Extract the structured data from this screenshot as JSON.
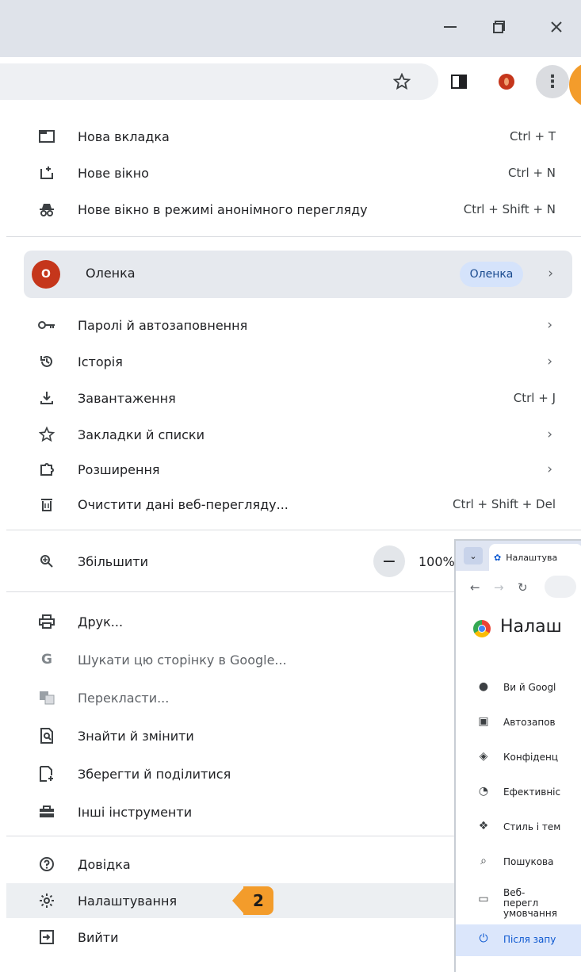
{
  "window": {
    "minimize_icon": "minimize-icon",
    "restore_icon": "restore-icon",
    "close_icon": "close-icon"
  },
  "toolbar": {
    "icons": [
      "star-icon",
      "side-panel-icon",
      "profile-avatar-icon",
      "more-vert-icon"
    ]
  },
  "menu": {
    "new_tab": {
      "label": "Нова вкладка",
      "shortcut": "Ctrl + T"
    },
    "new_window": {
      "label": "Нове вікно",
      "shortcut": "Ctrl + N"
    },
    "incognito": {
      "label": "Нове вікно в режимі анонімного перегляду",
      "shortcut": "Ctrl + Shift + N"
    },
    "profile": {
      "initial": "O",
      "name": "Оленка",
      "chip": "Оленка"
    },
    "passwords": {
      "label": "Паролі й автозаповнення"
    },
    "history": {
      "label": "Історія"
    },
    "downloads": {
      "label": "Завантаження",
      "shortcut": "Ctrl + J"
    },
    "bookmarks": {
      "label": "Закладки й списки"
    },
    "extensions": {
      "label": "Розширення"
    },
    "clear_data": {
      "label": "Очистити дані веб-перегляду...",
      "shortcut": "Ctrl + Shift + Del"
    },
    "zoom": {
      "label": "Збільшити",
      "minus": "−",
      "value": "100%"
    },
    "print": {
      "label": "Друк..."
    },
    "search_google": {
      "label": "Шукати цю сторінку в Google..."
    },
    "translate": {
      "label": "Перекласти..."
    },
    "find": {
      "label": "Знайти й змінити"
    },
    "save_share": {
      "label": "Зберегти й поділитися"
    },
    "more_tools": {
      "label": "Інші інструменти"
    },
    "help": {
      "label": "Довідка"
    },
    "settings": {
      "label": "Налаштування"
    },
    "exit": {
      "label": "Вийти"
    }
  },
  "callout": {
    "step": "2"
  },
  "inset": {
    "tab_dropdown": "⌄",
    "tab_title": "Налаштува",
    "page_title": "Налаш",
    "items": [
      {
        "icon": "person-icon",
        "label": "Ви й Googl"
      },
      {
        "icon": "clipboard-icon",
        "label": "Автозапов"
      },
      {
        "icon": "shield-icon",
        "label": "Конфіденц"
      },
      {
        "icon": "speedometer-icon",
        "label": "Ефективніс"
      },
      {
        "icon": "palette-icon",
        "label": "Стиль і тем"
      },
      {
        "icon": "search-icon",
        "label": "Пошукова"
      },
      {
        "icon": "browser-icon",
        "label": "Веб-перегл умовчання"
      },
      {
        "icon": "power-icon",
        "label": "Після запу"
      }
    ]
  },
  "colors": {
    "accent": "#f39c2b",
    "avatar": "#c5361b",
    "chip_bg": "#d5e3fb"
  }
}
